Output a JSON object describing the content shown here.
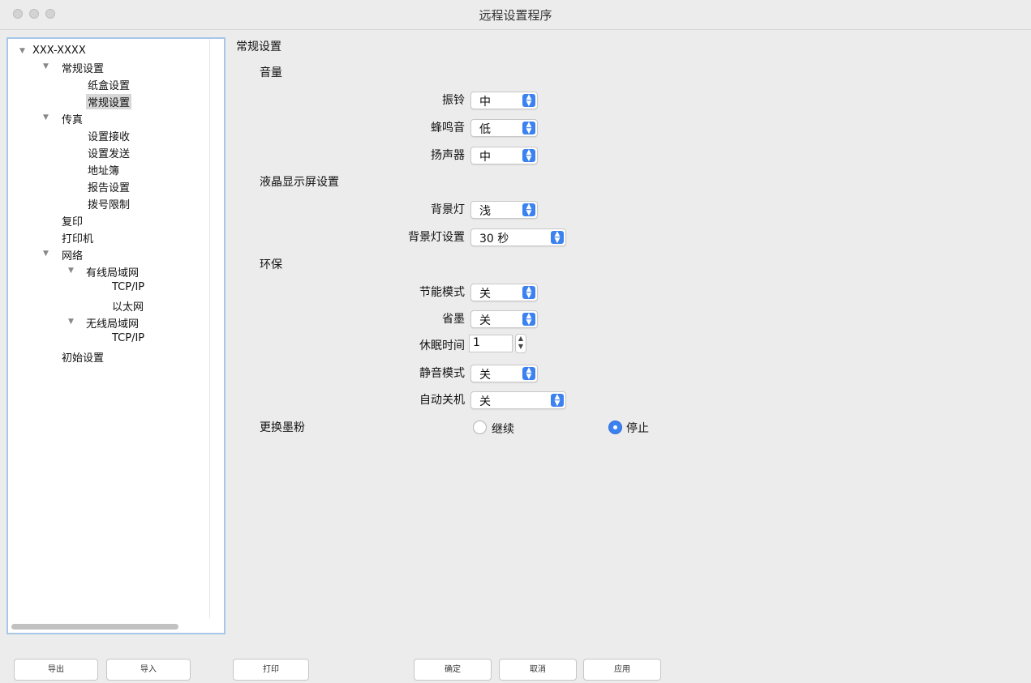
{
  "window": {
    "title": "远程设置程序"
  },
  "tree": {
    "nodes": [
      {
        "label": "XXX-XXXX"
      },
      {
        "label": "常规设置"
      },
      {
        "label": "纸盒设置"
      },
      {
        "label": "常规设置"
      },
      {
        "label": "传真"
      },
      {
        "label": "设置接收"
      },
      {
        "label": "设置发送"
      },
      {
        "label": "地址簿"
      },
      {
        "label": "报告设置"
      },
      {
        "label": "拨号限制"
      },
      {
        "label": "复印"
      },
      {
        "label": "打印机"
      },
      {
        "label": "网络"
      },
      {
        "label": "有线局域网"
      },
      {
        "label": "TCP/IP"
      },
      {
        "label": "以太网"
      },
      {
        "label": "无线局域网"
      },
      {
        "label": "TCP/IP"
      },
      {
        "label": "初始设置"
      }
    ]
  },
  "content": {
    "title": "常规设置",
    "volume": {
      "heading": "音量",
      "ring_label": "振铃",
      "ring_value": "中",
      "beep_label": "蜂鸣音",
      "beep_value": "低",
      "speaker_label": "扬声器",
      "speaker_value": "中"
    },
    "lcd": {
      "heading": "液晶显示屏设置",
      "backlight_label": "背景灯",
      "backlight_value": "浅",
      "backlight_timer_label": "背景灯设置",
      "backlight_timer_value": "30 秒"
    },
    "eco": {
      "heading": "环保",
      "eco_mode_label": "节能模式",
      "eco_mode_value": "关",
      "toner_save_label": "省墨",
      "toner_save_value": "关",
      "sleep_time_label": "休眠时间",
      "sleep_time_value": "1",
      "quiet_mode_label": "静音模式",
      "quiet_mode_value": "关",
      "auto_off_label": "自动关机",
      "auto_off_value": "关"
    },
    "replace_toner": {
      "heading": "更换墨粉",
      "continue_label": "继续",
      "stop_label": "停止",
      "selected": "停止"
    }
  },
  "buttons": {
    "export": "导出",
    "import": "导入",
    "print": "打印",
    "ok": "确定",
    "cancel": "取消",
    "apply": "应用"
  },
  "colors": {
    "accent": "#3b82f0",
    "tree_border": "#a7c6e8"
  }
}
